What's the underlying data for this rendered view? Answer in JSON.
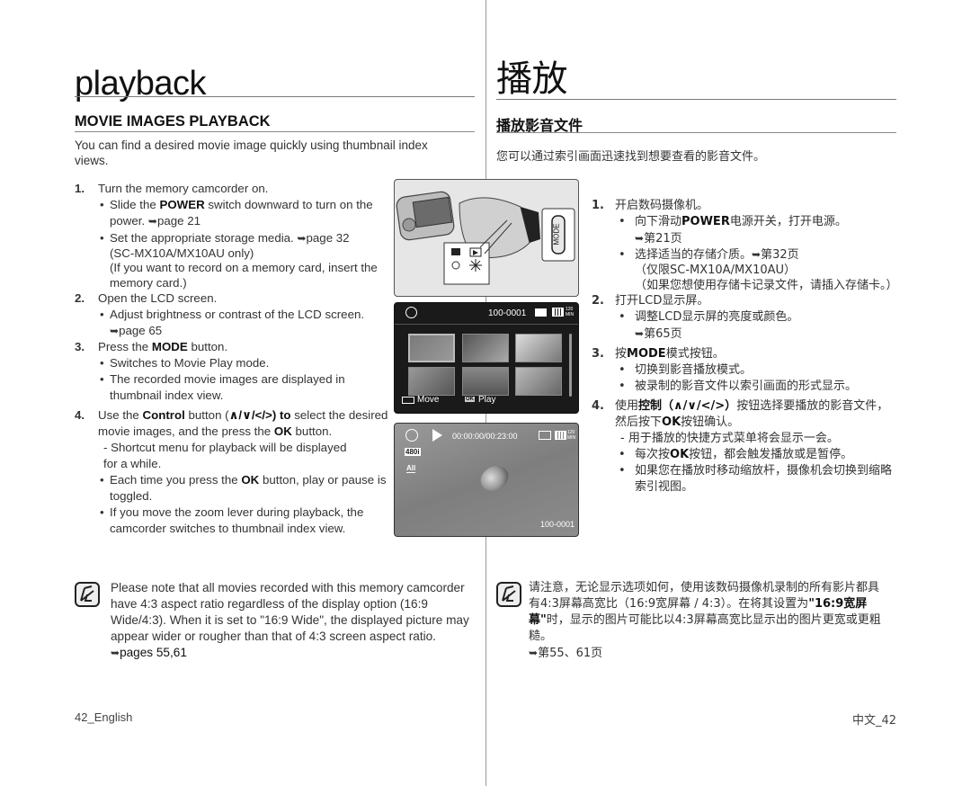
{
  "english": {
    "title": "playback",
    "section_title": "MOVIE IMAGES PLAYBACK",
    "intro": "You can find a desired movie image quickly using thumbnail index views.",
    "steps": [
      {
        "num": "1.",
        "text": "Turn the memory camcorder on.",
        "subs": [
          {
            "pre": "Slide the ",
            "bold": "POWER",
            "post": " switch downward to turn on the power. ",
            "ref": "page 21"
          },
          {
            "pre": "Set the appropriate storage media. ",
            "ref": "page 32",
            "extra1": "(SC-MX10A/MX10AU only)",
            "extra2": "(If you want to record on a memory card, insert the memory card.)"
          }
        ]
      },
      {
        "num": "2.",
        "text": "Open the LCD screen.",
        "subs": [
          {
            "pre": "Adjust brightness or contrast of the LCD screen. ",
            "ref": "page 65"
          }
        ]
      },
      {
        "num": "3.",
        "text_pre": "Press the ",
        "text_bold": "MODE",
        "text_post": " button.",
        "subs": [
          {
            "text": "Switches to Movie Play mode."
          },
          {
            "text": "The recorded movie images are displayed in thumbnail index view."
          }
        ]
      },
      {
        "num": "4.",
        "text_pre": "Use the ",
        "text_bold": "Control",
        "text_mid": " button (",
        "arrows": "∧/∨/</>",
        "text_bold2": ") to",
        "text_post": " select the desired movie images, and the press the ",
        "text_bold3": "OK",
        "text_end": " button.",
        "dash": "- Shortcut menu for playback will be displayed for a while.",
        "subs": [
          {
            "pre": "Each time you press the ",
            "bold": "OK",
            "post": " button, play or pause is toggled."
          },
          {
            "text": "If you move the zoom lever during playback, the camcorder switches to thumbnail index view."
          }
        ]
      }
    ],
    "note": {
      "text": "Please note that all movies recorded with this memory camcorder have 4:3 aspect ratio regardless of the display option (16:9 Wide/4:3). When it is set to \"16:9 Wide\", the displayed picture may appear wider or rougher than that of 4:3 screen aspect ratio. ",
      "ref": "pages 55,61"
    },
    "footer": "42_English"
  },
  "chinese": {
    "title": "播放",
    "section_title": "播放影音文件",
    "intro": "您可以通过索引画面迅速找到想要查看的影音文件。",
    "steps": [
      {
        "num": "1.",
        "text": "开启数码摄像机。",
        "subs": [
          {
            "pre": "向下滑动",
            "bold": "POWER",
            "post": "电源开关，打开电源。",
            "ref": "第21页"
          },
          {
            "pre": "选择适当的存储介质。",
            "ref": "第32页",
            "extra1": "（仅限SC-MX10A/MX10AU）",
            "extra2": "（如果您想使用存储卡记录文件，请插入存储卡。）"
          }
        ]
      },
      {
        "num": "2.",
        "text": "打开LCD显示屏。",
        "subs": [
          {
            "pre": "调整LCD显示屏的亮度或颜色。",
            "ref": "第65页"
          }
        ]
      },
      {
        "num": "3.",
        "text_pre": "按",
        "text_bold": "MODE",
        "text_post": "模式按钮。",
        "subs": [
          {
            "text": "切换到影音播放模式。"
          },
          {
            "text": "被录制的影音文件以索引画面的形式显示。"
          }
        ]
      },
      {
        "num": "4.",
        "text_pre": "使用",
        "text_bold": "控制",
        "arrows": "（∧/∨/</>）",
        "text_post": "按钮选择要播放的影音文件，然后按下",
        "text_bold3": "OK",
        "text_end": "按钮确认。",
        "dash": "- 用于播放的快捷方式菜单将会显示一会。",
        "subs": [
          {
            "pre": "每次按",
            "bold": "OK",
            "post": "按钮，都会触发播放或是暂停。"
          },
          {
            "text": "如果您在播放时移动缩放杆，摄像机会切换到缩略索引视图。"
          }
        ]
      }
    ],
    "note": {
      "text_pre": "请注意，无论显示选项如何，使用该数码摄像机录制的所有影片都具有4:3屏幕高宽比（16:9宽屏幕 / 4:3）。在将其设置为",
      "text_bold": "\"16:9宽屏幕\"",
      "text_post": "时，显示的图片可能比以4:3屏幕高宽比显示出的图片更宽或更粗糙。",
      "ref": "第55、61页"
    },
    "footer": "中文_42"
  },
  "figures": {
    "camera": {
      "mode_label": "MODE"
    },
    "index_screen": {
      "file_number": "100-0001",
      "battery_time": "120 MIN",
      "move_label": "Move",
      "play_label": "Play",
      "ok_label": "OK"
    },
    "play_screen": {
      "timecode": "00:00:00/00:23:00",
      "quality_badge": "480i",
      "all_badge": "All",
      "file_number": "100-0001",
      "battery_time": "120 MIN"
    }
  },
  "ref_arrow": "➥"
}
